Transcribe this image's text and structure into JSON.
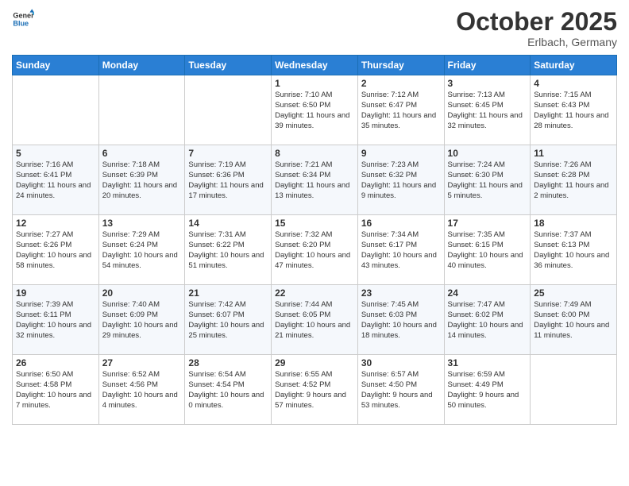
{
  "header": {
    "logo_general": "General",
    "logo_blue": "Blue",
    "month": "October 2025",
    "location": "Erlbach, Germany"
  },
  "days_of_week": [
    "Sunday",
    "Monday",
    "Tuesday",
    "Wednesday",
    "Thursday",
    "Friday",
    "Saturday"
  ],
  "weeks": [
    [
      {
        "num": "",
        "info": ""
      },
      {
        "num": "",
        "info": ""
      },
      {
        "num": "",
        "info": ""
      },
      {
        "num": "1",
        "info": "Sunrise: 7:10 AM\nSunset: 6:50 PM\nDaylight: 11 hours\nand 39 minutes."
      },
      {
        "num": "2",
        "info": "Sunrise: 7:12 AM\nSunset: 6:47 PM\nDaylight: 11 hours\nand 35 minutes."
      },
      {
        "num": "3",
        "info": "Sunrise: 7:13 AM\nSunset: 6:45 PM\nDaylight: 11 hours\nand 32 minutes."
      },
      {
        "num": "4",
        "info": "Sunrise: 7:15 AM\nSunset: 6:43 PM\nDaylight: 11 hours\nand 28 minutes."
      }
    ],
    [
      {
        "num": "5",
        "info": "Sunrise: 7:16 AM\nSunset: 6:41 PM\nDaylight: 11 hours\nand 24 minutes."
      },
      {
        "num": "6",
        "info": "Sunrise: 7:18 AM\nSunset: 6:39 PM\nDaylight: 11 hours\nand 20 minutes."
      },
      {
        "num": "7",
        "info": "Sunrise: 7:19 AM\nSunset: 6:36 PM\nDaylight: 11 hours\nand 17 minutes."
      },
      {
        "num": "8",
        "info": "Sunrise: 7:21 AM\nSunset: 6:34 PM\nDaylight: 11 hours\nand 13 minutes."
      },
      {
        "num": "9",
        "info": "Sunrise: 7:23 AM\nSunset: 6:32 PM\nDaylight: 11 hours\nand 9 minutes."
      },
      {
        "num": "10",
        "info": "Sunrise: 7:24 AM\nSunset: 6:30 PM\nDaylight: 11 hours\nand 5 minutes."
      },
      {
        "num": "11",
        "info": "Sunrise: 7:26 AM\nSunset: 6:28 PM\nDaylight: 11 hours\nand 2 minutes."
      }
    ],
    [
      {
        "num": "12",
        "info": "Sunrise: 7:27 AM\nSunset: 6:26 PM\nDaylight: 10 hours\nand 58 minutes."
      },
      {
        "num": "13",
        "info": "Sunrise: 7:29 AM\nSunset: 6:24 PM\nDaylight: 10 hours\nand 54 minutes."
      },
      {
        "num": "14",
        "info": "Sunrise: 7:31 AM\nSunset: 6:22 PM\nDaylight: 10 hours\nand 51 minutes."
      },
      {
        "num": "15",
        "info": "Sunrise: 7:32 AM\nSunset: 6:20 PM\nDaylight: 10 hours\nand 47 minutes."
      },
      {
        "num": "16",
        "info": "Sunrise: 7:34 AM\nSunset: 6:17 PM\nDaylight: 10 hours\nand 43 minutes."
      },
      {
        "num": "17",
        "info": "Sunrise: 7:35 AM\nSunset: 6:15 PM\nDaylight: 10 hours\nand 40 minutes."
      },
      {
        "num": "18",
        "info": "Sunrise: 7:37 AM\nSunset: 6:13 PM\nDaylight: 10 hours\nand 36 minutes."
      }
    ],
    [
      {
        "num": "19",
        "info": "Sunrise: 7:39 AM\nSunset: 6:11 PM\nDaylight: 10 hours\nand 32 minutes."
      },
      {
        "num": "20",
        "info": "Sunrise: 7:40 AM\nSunset: 6:09 PM\nDaylight: 10 hours\nand 29 minutes."
      },
      {
        "num": "21",
        "info": "Sunrise: 7:42 AM\nSunset: 6:07 PM\nDaylight: 10 hours\nand 25 minutes."
      },
      {
        "num": "22",
        "info": "Sunrise: 7:44 AM\nSunset: 6:05 PM\nDaylight: 10 hours\nand 21 minutes."
      },
      {
        "num": "23",
        "info": "Sunrise: 7:45 AM\nSunset: 6:03 PM\nDaylight: 10 hours\nand 18 minutes."
      },
      {
        "num": "24",
        "info": "Sunrise: 7:47 AM\nSunset: 6:02 PM\nDaylight: 10 hours\nand 14 minutes."
      },
      {
        "num": "25",
        "info": "Sunrise: 7:49 AM\nSunset: 6:00 PM\nDaylight: 10 hours\nand 11 minutes."
      }
    ],
    [
      {
        "num": "26",
        "info": "Sunrise: 6:50 AM\nSunset: 4:58 PM\nDaylight: 10 hours\nand 7 minutes."
      },
      {
        "num": "27",
        "info": "Sunrise: 6:52 AM\nSunset: 4:56 PM\nDaylight: 10 hours\nand 4 minutes."
      },
      {
        "num": "28",
        "info": "Sunrise: 6:54 AM\nSunset: 4:54 PM\nDaylight: 10 hours\nand 0 minutes."
      },
      {
        "num": "29",
        "info": "Sunrise: 6:55 AM\nSunset: 4:52 PM\nDaylight: 9 hours\nand 57 minutes."
      },
      {
        "num": "30",
        "info": "Sunrise: 6:57 AM\nSunset: 4:50 PM\nDaylight: 9 hours\nand 53 minutes."
      },
      {
        "num": "31",
        "info": "Sunrise: 6:59 AM\nSunset: 4:49 PM\nDaylight: 9 hours\nand 50 minutes."
      },
      {
        "num": "",
        "info": ""
      }
    ]
  ]
}
